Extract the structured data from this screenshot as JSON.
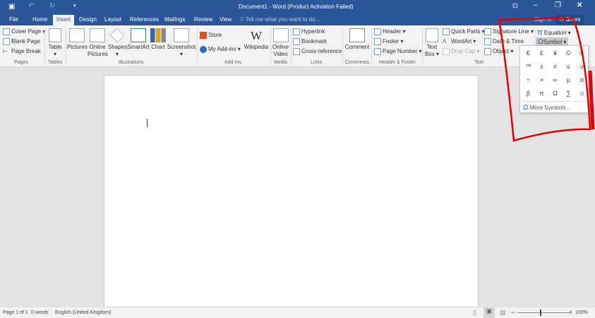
{
  "window": {
    "title": "Document1 - Word (Product Activation Failed)",
    "sign_in": "Sign in",
    "share": "Share"
  },
  "tabs": [
    "File",
    "Home",
    "Insert",
    "Design",
    "Layout",
    "References",
    "Mailings",
    "Review",
    "View"
  ],
  "tell_me": "Tell me what you want to do...",
  "ribbon": {
    "pages": {
      "cover_page": "Cover Page",
      "blank_page": "Blank Page",
      "page_break": "Page Break",
      "label": "Pages"
    },
    "tables": {
      "table": "Table",
      "label": "Tables"
    },
    "illustrations": {
      "pictures": "Pictures",
      "online_pictures_1": "Online",
      "online_pictures_2": "Pictures",
      "shapes": "Shapes",
      "smartart": "SmartArt",
      "chart": "Chart",
      "screenshot": "Screenshot",
      "label": "Illustrations"
    },
    "addins": {
      "store": "Store",
      "my_addins": "My Add-ins",
      "wikipedia": "Wikipedia",
      "label": "Add-ins"
    },
    "media": {
      "online_video_1": "Online",
      "online_video_2": "Video",
      "label": "Media"
    },
    "links": {
      "hyperlink": "Hyperlink",
      "bookmark": "Bookmark",
      "cross_reference": "Cross-reference",
      "label": "Links"
    },
    "comments": {
      "comment": "Comment",
      "label": "Comments"
    },
    "header_footer": {
      "header": "Header",
      "footer": "Footer",
      "page_number": "Page Number",
      "label": "Header & Footer"
    },
    "text": {
      "text_box_1": "Text",
      "text_box_2": "Box",
      "quick_parts": "Quick Parts",
      "wordart": "WordArt",
      "drop_cap": "Drop Cap",
      "signature_line": "Signature Line",
      "date_time": "Date & Time",
      "object": "Object",
      "label": "Text"
    },
    "symbols": {
      "equation": "Equation",
      "symbol": "Symbol"
    }
  },
  "symbol_dropdown": {
    "symbols": [
      "€",
      "£",
      "¥",
      "©",
      "®",
      "™",
      "±",
      "≠",
      "≤",
      "≥",
      "÷",
      "×",
      "∞",
      "µ",
      "α",
      "β",
      "π",
      "Ω",
      "∑",
      "☺"
    ],
    "more": "More Symbols..."
  },
  "status": {
    "page": "Page 1 of 1",
    "words": "0 words",
    "language": "English (United Kingdom)",
    "zoom": "100%"
  },
  "colors": {
    "brand": "#2b579a",
    "annotation": "#e00000"
  }
}
